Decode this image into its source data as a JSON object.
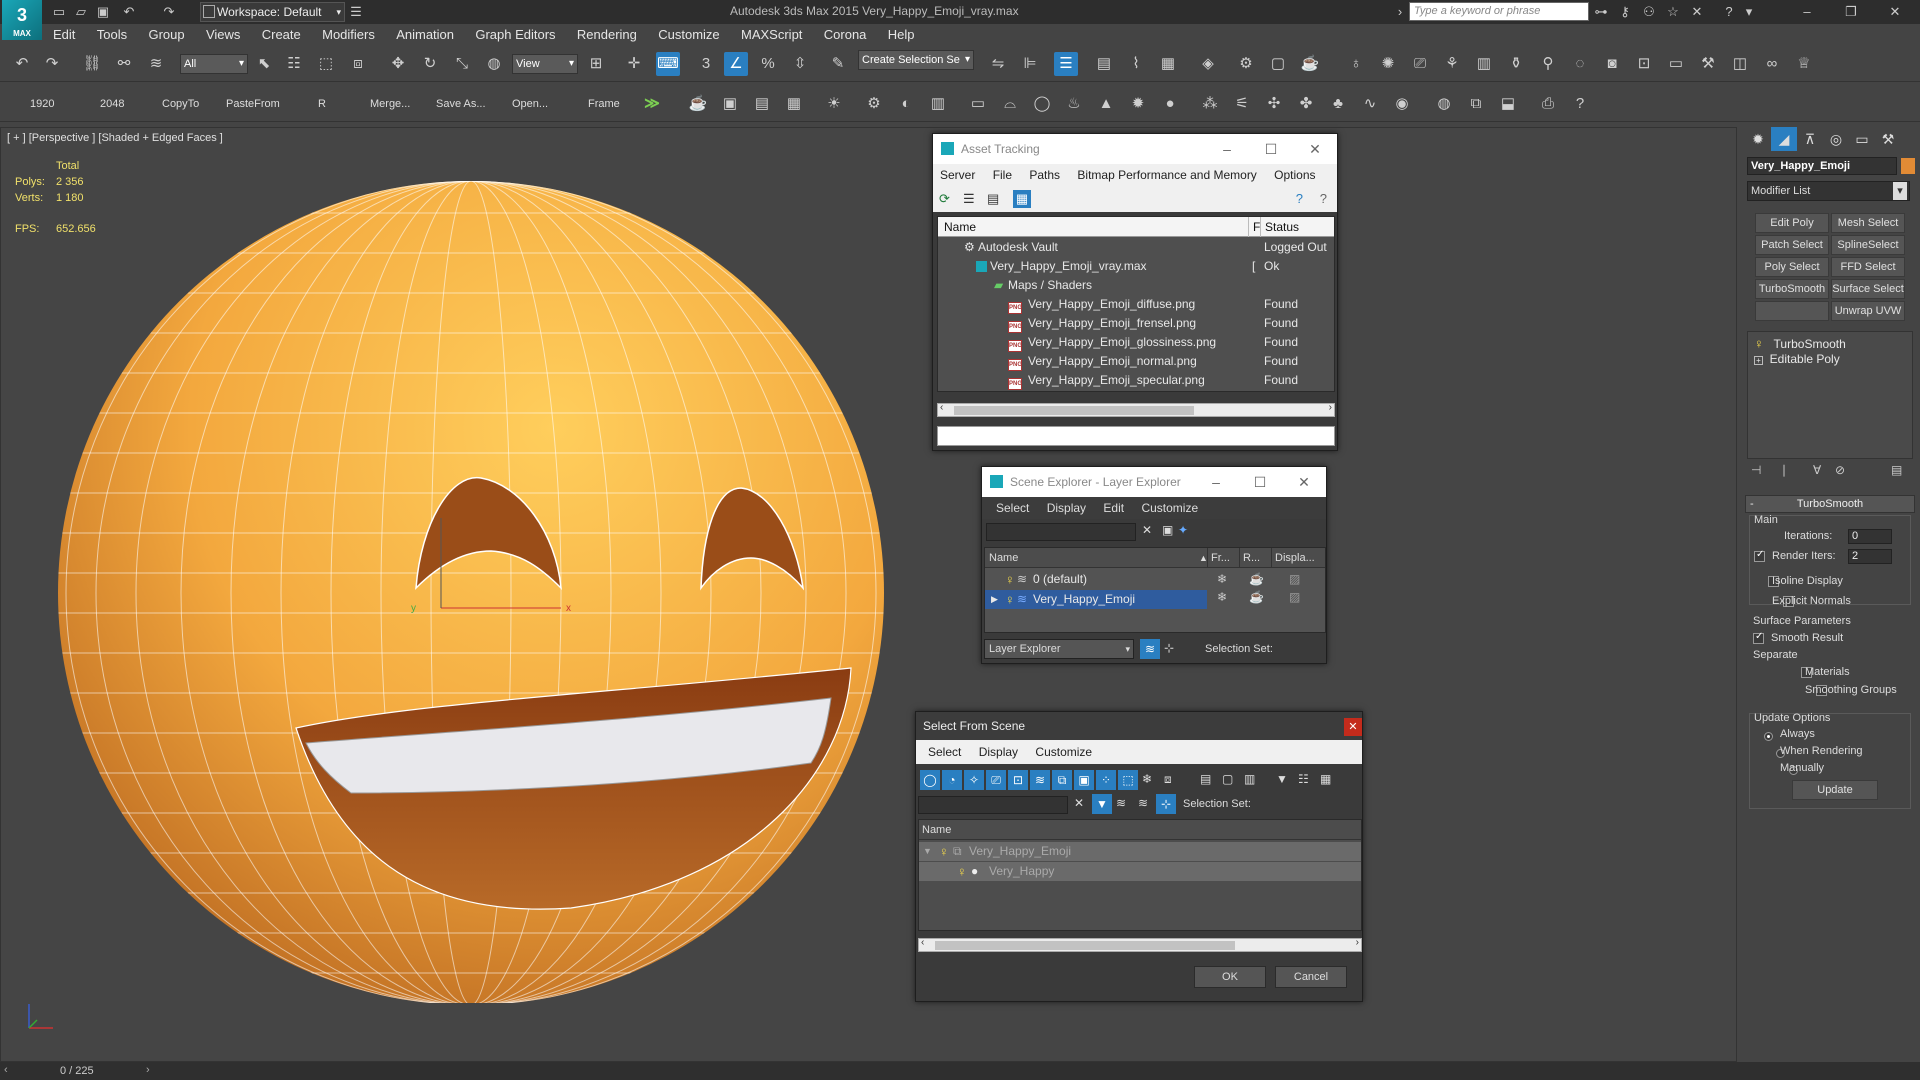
{
  "app": {
    "title": "Autodesk 3ds Max  2015    Very_Happy_Emoji_vray.max",
    "logo_text": "3",
    "logo_sub": "MAX",
    "workspace": "Workspace: Default",
    "search_placeholder": "Type a keyword or phrase"
  },
  "menu": [
    "Edit",
    "Tools",
    "Group",
    "Views",
    "Create",
    "Modifiers",
    "Animation",
    "Graph Editors",
    "Rendering",
    "Customize",
    "MAXScript",
    "Corona",
    "Help"
  ],
  "toolbar1": {
    "filter_value": "All",
    "refcoord_value": "View",
    "selection_set_placeholder": "Create Selection Se"
  },
  "toolbar2": {
    "labels": [
      "1920",
      "2048",
      "CopyTo",
      "PasteFrom",
      "R",
      "Merge...",
      "Save As...",
      "Open...",
      "Frame"
    ]
  },
  "viewport": {
    "label": "[ + ] [Perspective ] [Shaded + Edged Faces ]",
    "stats": {
      "total_label": "Total",
      "polys_label": "Polys:",
      "polys_value": "2 356",
      "verts_label": "Verts:",
      "verts_value": "1 180",
      "fps_label": "FPS:",
      "fps_value": "652.656"
    },
    "gizmo_x": "x",
    "gizmo_y": "y"
  },
  "timeline": {
    "label": "0 / 225"
  },
  "command_panel": {
    "object_name": "Very_Happy_Emoji",
    "object_color": "#e28b35",
    "modifier_list": "Modifier List",
    "modifier_buttons": [
      "Edit Poly",
      "Mesh Select",
      "Patch Select",
      "SplineSelect",
      "Poly Select",
      "FFD Select",
      "TurboSmooth",
      "Surface Select",
      "Unwrap UVW"
    ],
    "stack": [
      "TurboSmooth",
      "Editable Poly"
    ],
    "rollout_title": "TurboSmooth",
    "main_label": "Main",
    "iterations_label": "Iterations:",
    "iterations_value": "0",
    "render_iters_label": "Render Iters:",
    "render_iters_value": "2",
    "isoline_label": "Isoline Display",
    "explicit_normals_label": "Explicit Normals",
    "surface_params_label": "Surface Parameters",
    "smooth_result_label": "Smooth Result",
    "separate_label": "Separate",
    "materials_label": "Materials",
    "smoothing_groups_label": "Smoothing Groups",
    "update_options_label": "Update Options",
    "always_label": "Always",
    "when_rendering_label": "When Rendering",
    "manually_label": "Manually",
    "update_button": "Update"
  },
  "asset_tracking": {
    "title": "Asset Tracking",
    "menu": [
      "Server",
      "File",
      "Paths",
      "Bitmap Performance and Memory",
      "Options"
    ],
    "columns": [
      "Name",
      "F",
      "Status"
    ],
    "rows": [
      {
        "name": "Autodesk Vault",
        "f": "",
        "status": "Logged Out"
      },
      {
        "name": "Very_Happy_Emoji_vray.max",
        "f": "[",
        "status": "Ok"
      },
      {
        "name": "Maps / Shaders",
        "f": "",
        "status": ""
      },
      {
        "name": "Very_Happy_Emoji_diffuse.png",
        "f": "",
        "status": "Found"
      },
      {
        "name": "Very_Happy_Emoji_frensel.png",
        "f": "",
        "status": "Found"
      },
      {
        "name": "Very_Happy_Emoji_glossiness.png",
        "f": "",
        "status": "Found"
      },
      {
        "name": "Very_Happy_Emoji_normal.png",
        "f": "",
        "status": "Found"
      },
      {
        "name": "Very_Happy_Emoji_specular.png",
        "f": "",
        "status": "Found"
      }
    ],
    "png_badge": "PNG"
  },
  "scene_explorer": {
    "title": "Scene Explorer - Layer Explorer",
    "menu": [
      "Select",
      "Display",
      "Edit",
      "Customize"
    ],
    "columns": [
      "Name",
      "Fr...",
      "R...",
      "Displa..."
    ],
    "rows": [
      {
        "name": "0 (default)"
      },
      {
        "name": "Very_Happy_Emoji"
      }
    ],
    "footer_dropdown": "Layer Explorer",
    "selection_set_label": "Selection Set:"
  },
  "select_from_scene": {
    "title": "Select From Scene",
    "menu": [
      "Select",
      "Display",
      "Customize"
    ],
    "selection_set_label": "Selection Set:",
    "column": "Name",
    "rows": [
      {
        "name": "Very_Happy_Emoji"
      },
      {
        "name": "Very_Happy"
      }
    ],
    "ok_label": "OK",
    "cancel_label": "Cancel"
  }
}
